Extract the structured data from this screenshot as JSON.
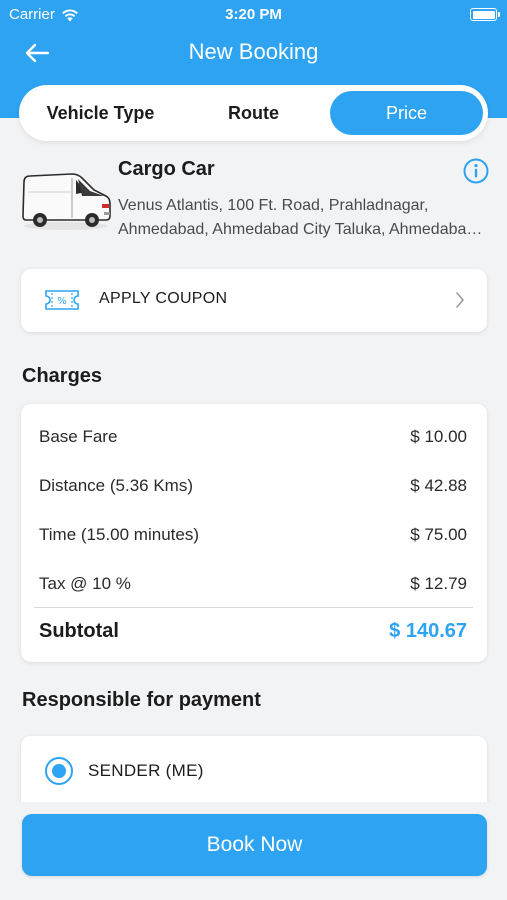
{
  "status_bar": {
    "carrier": "Carrier",
    "time": "3:20 PM"
  },
  "nav": {
    "title": "New Booking"
  },
  "tabs": [
    {
      "label": "Vehicle Type",
      "active": false
    },
    {
      "label": "Route",
      "active": false
    },
    {
      "label": "Price",
      "active": true
    }
  ],
  "vehicle": {
    "name": "Cargo Car",
    "address_line1": "Venus Atlantis, 100 Ft. Road, Prahladnagar,",
    "address_line2": "Ahmedabad, Ahmedabad City Taluka, Ahmedabad, Gujarat"
  },
  "coupon": {
    "label": "APPLY COUPON",
    "icon": "coupon-ticket-icon"
  },
  "charges": {
    "title": "Charges",
    "rows": [
      {
        "label": "Base Fare",
        "value": "$ 10.00"
      },
      {
        "label": "Distance (5.36 Kms)",
        "value": "$ 42.88"
      },
      {
        "label": "Time (15.00 minutes)",
        "value": "$ 75.00"
      },
      {
        "label": "Tax @ 10 %",
        "value": "$ 12.79"
      }
    ],
    "subtotal_label": "Subtotal",
    "subtotal_value": "$ 140.67"
  },
  "payment": {
    "title": "Responsible for payment",
    "options": [
      {
        "label": "SENDER (ME)",
        "selected": true
      }
    ]
  },
  "book_button": {
    "label": "Book Now"
  },
  "colors": {
    "accent": "#2ea3f2",
    "background": "#f2f3f5"
  }
}
